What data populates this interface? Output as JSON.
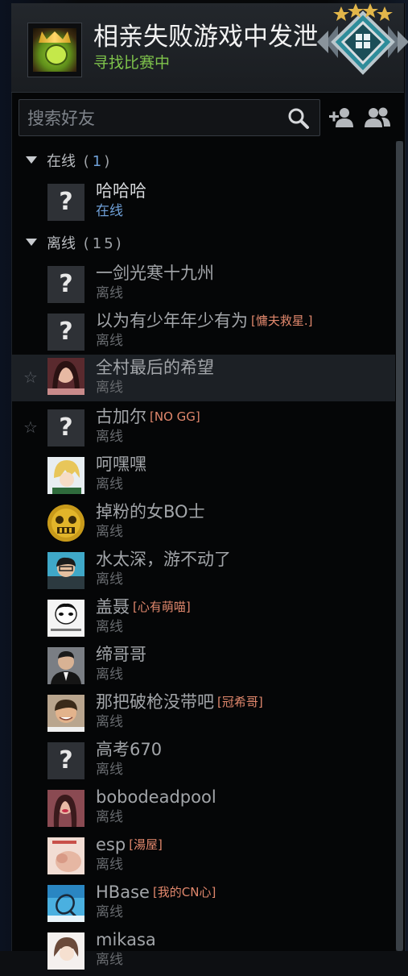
{
  "me": {
    "name": "相亲失败游戏中发泄",
    "status": "寻找比赛中"
  },
  "search": {
    "placeholder": "搜索好友"
  },
  "groups": {
    "online": {
      "label": "在线",
      "count": "1"
    },
    "offline": {
      "label": "离线",
      "count": "15"
    }
  },
  "friends": [
    {
      "name": "哈哈哈",
      "status": "在线",
      "tag": ""
    },
    {
      "name": "一剑光寒十九州",
      "status": "离线",
      "tag": ""
    },
    {
      "name": "以为有少年年少有为",
      "status": "离线",
      "tag": "[慵夫救星.]"
    },
    {
      "name": "全村最后的希望",
      "status": "离线",
      "tag": ""
    },
    {
      "name": "古加尔",
      "status": "离线",
      "tag": "[NO GG]"
    },
    {
      "name": "呵嘿嘿",
      "status": "离线",
      "tag": ""
    },
    {
      "name": "掉粉的女BO士",
      "status": "离线",
      "tag": ""
    },
    {
      "name": "水太深，游不动了",
      "status": "离线",
      "tag": ""
    },
    {
      "name": "盖聂",
      "status": "离线",
      "tag": "[心有萌喵]"
    },
    {
      "name": "缔哥哥",
      "status": "离线",
      "tag": ""
    },
    {
      "name": "那把破枪没带吧",
      "status": "离线",
      "tag": "[冠希哥]"
    },
    {
      "name": "高考670",
      "status": "离线",
      "tag": ""
    },
    {
      "name": "bobodeadpool",
      "status": "离线",
      "tag": ""
    },
    {
      "name": "esp",
      "status": "离线",
      "tag": "[湯屋]"
    },
    {
      "name": "HBase",
      "status": "离线",
      "tag": "[我的CN心]"
    },
    {
      "name": "mikasa",
      "status": "离线",
      "tag": ""
    }
  ],
  "colors": {
    "online": "#6fa0d8",
    "in_game": "#7ec34b",
    "tag": "#e0876c"
  }
}
